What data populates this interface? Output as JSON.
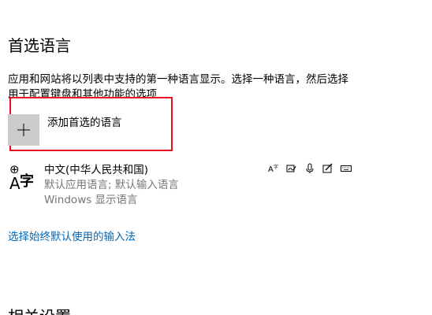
{
  "preferred_languages": {
    "title": "首选语言",
    "description": "应用和网站将以列表中支持的第一种语言显示。选择一种语言，然后选择\n用于配置键盘和其他功能的选项",
    "add_button_label": "添加首选的语言",
    "plus_icon": "plus-icon",
    "languages": [
      {
        "name": "中文(中华人民共和国)",
        "line2": "默认应用语言; 默认输入语言",
        "line3": "Windows 显示语言",
        "icon": "language-icon",
        "glyph_top": "⊕",
        "glyph_a": "A",
        "glyph_zi": "字",
        "feature_icons": [
          "display-language-icon",
          "handwriting-icon",
          "speech-icon",
          "pen-icon",
          "keyboard-icon"
        ]
      }
    ],
    "input_method_link": "选择始终默认使用的输入法"
  },
  "next_section": {
    "title": "相关设置"
  },
  "colors": {
    "highlight_border": "#e81123",
    "link": "#0067b8",
    "secondary_text": "#767676",
    "tile": "#cccccc"
  }
}
